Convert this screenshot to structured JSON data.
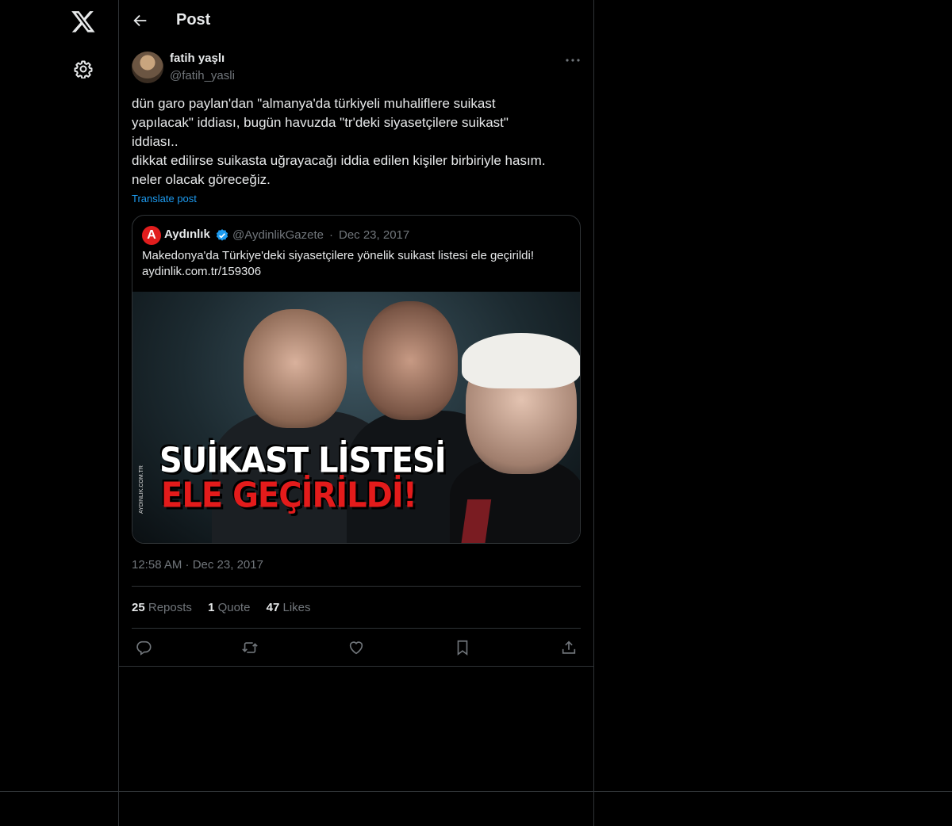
{
  "header": {
    "title": "Post"
  },
  "post": {
    "author_name": "fatih yaşlı",
    "author_handle": "@fatih_yasli",
    "text": "dün garo paylan'dan \"almanya'da türkiyeli muhaliflere suikast\nyapılacak\" iddiası, bugün havuzda \"tr'deki siyasetçilere suikast\"\niddiası..\ndikkat edilirse suikasta uğrayacağı iddia edilen kişiler birbiriyle hasım.\nneler olacak göreceğiz.",
    "translate_label": "Translate post",
    "timestamp": "12:58 AM · Dec 23, 2017",
    "stats": {
      "reposts_count": "25",
      "reposts_label": "Reposts",
      "quotes_count": "1",
      "quotes_label": "Quote",
      "likes_count": "47",
      "likes_label": "Likes"
    }
  },
  "quoted": {
    "logo_letter": "A",
    "name": "Aydınlık",
    "handle": "@AydinlikGazete",
    "separator": "·",
    "date": "Dec 23, 2017",
    "text": "Makedonya'da Türkiye'deki siyasetçilere yönelik suikast listesi ele geçirildi!\naydinlik.com.tr/159306",
    "image": {
      "headline_line1": "SUİKAST LİSTESİ",
      "headline_line2": "ELE GEÇİRİLDİ!",
      "watermark": "AYDINLIK.COM.TR"
    }
  },
  "icons": {
    "logo": "x-logo-icon",
    "settings": "gear-icon",
    "back": "arrow-left-icon",
    "more": "more-horizontal-icon",
    "verified": "verified-badge-icon",
    "reply": "reply-icon",
    "retweet": "retweet-icon",
    "like": "heart-icon",
    "bookmark": "bookmark-icon",
    "share": "share-icon"
  },
  "colors": {
    "background": "#000000",
    "text": "#e7e9ea",
    "muted": "#71767b",
    "accent": "#1d9bf0",
    "border": "#2f3336"
  }
}
